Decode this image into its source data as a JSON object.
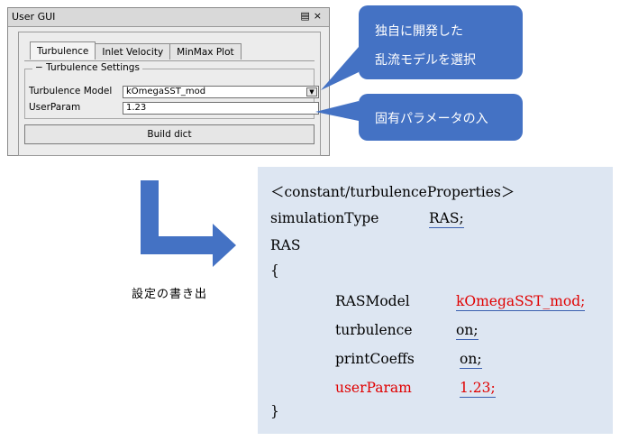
{
  "window": {
    "title": "User GUI",
    "title_buttons": "b ×",
    "tabs": [
      "Turbulence",
      "Inlet Velocity",
      "MinMax Plot"
    ],
    "group_title": "− Turbulence Settings",
    "model_label": "Turbulence Model",
    "model_value": "kOmegaSST_mod",
    "param_label": "UserParam",
    "param_value": "1.23",
    "build_button": "Build dict"
  },
  "callouts": {
    "c1_line1": "独自に開発した",
    "c1_line2": "乱流モデルを選択",
    "c2_line1": "固有パラメータの入"
  },
  "caption": "設定の書き出",
  "code": {
    "header": "＜constant/turbulenceProperties＞",
    "sim_key": "simulationType",
    "sim_val": "RAS;",
    "ras": "RAS",
    "open": "{",
    "model_key": "RASModel",
    "model_val": "kOmegaSST_mod;",
    "turb_key": "turbulence",
    "turb_val": "on;",
    "print_key": "printCoeffs",
    "print_val": "on;",
    "param_key": "userParam",
    "param_val": "1.23;",
    "close": "}"
  },
  "colors": {
    "callout": "#4472c4",
    "arrow": "#4472c4",
    "code_bg": "#dde6f2",
    "highlight": "#e00000"
  }
}
